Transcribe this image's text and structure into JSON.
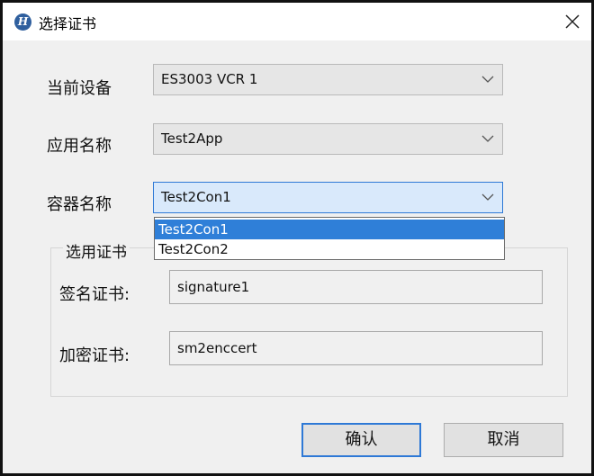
{
  "dialog": {
    "title": "选择证书"
  },
  "form": {
    "device": {
      "label": "当前设备",
      "value": "ES3003 VCR 1"
    },
    "app_name": {
      "label": "应用名称",
      "value": "Test2App"
    },
    "container": {
      "label": "容器名称",
      "value": "Test2Con1",
      "options": [
        "Test2Con1",
        "Test2Con2"
      ],
      "selected_index": 0
    }
  },
  "cert_group": {
    "title": "选用证书",
    "signing": {
      "label": "签名证书:",
      "value": "signature1"
    },
    "encryption": {
      "label": "加密证书:",
      "value": "sm2enccert"
    }
  },
  "buttons": {
    "confirm": "确认",
    "cancel": "取消"
  },
  "colors": {
    "accent": "#2e79d6",
    "selection": "#2f7fd8",
    "dialog_bg": "#f0f0f0"
  },
  "icons": {
    "app": "hx-logo-icon",
    "close": "close-icon",
    "dropdown": "chevron-down-icon"
  }
}
